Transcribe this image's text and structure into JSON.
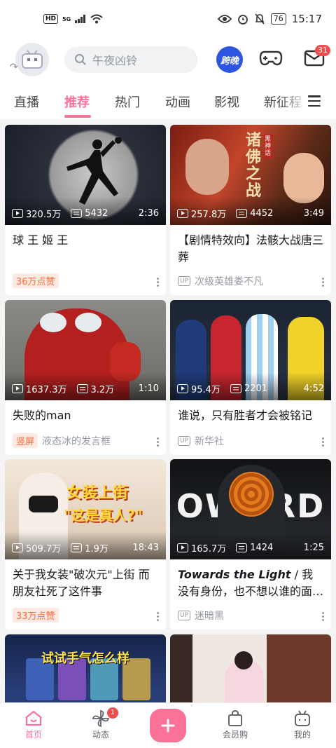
{
  "status_bar": {
    "left_hd": "HD",
    "left_sig": "5G",
    "battery": "76",
    "time": "15:17"
  },
  "header": {
    "search_placeholder": "午夜凶铃",
    "kuawan_label": "跨晚",
    "mail_badge": "31"
  },
  "tabs": [
    {
      "label": "直播",
      "active": false
    },
    {
      "label": "推荐",
      "active": true
    },
    {
      "label": "热门",
      "active": false
    },
    {
      "label": "动画",
      "active": false
    },
    {
      "label": "影视",
      "active": false
    },
    {
      "label": "新征程",
      "active": false
    }
  ],
  "cards": [
    {
      "views": "320.5万",
      "danmaku": "5432",
      "duration": "2:36",
      "title": "球 王 姬 王",
      "tag": "36万点赞",
      "author": ""
    },
    {
      "views": "257.8万",
      "danmaku": "4452",
      "duration": "3:49",
      "title": "【剧情特效向】法骸大战唐三葬",
      "tag": "",
      "up": "UP",
      "author": "次级英雄娄不凡"
    },
    {
      "views": "1637.3万",
      "danmaku": "3.2万",
      "duration": "1:10",
      "title": "失败的man",
      "tag": "竖屏",
      "author": "液态冰的发言框"
    },
    {
      "views": "95.4万",
      "danmaku": "2201",
      "duration": "4:52",
      "title": "谁说，只有胜者才会被铭记",
      "tag": "",
      "up": "UP",
      "author": "新华社"
    },
    {
      "views": "509.7万",
      "danmaku": "1.9万",
      "duration": "18:43",
      "title": "关于我女装\"破次元\"上街 而朋友社死了这件事",
      "tag": "33万点赞",
      "author": ""
    },
    {
      "views": "165.7万",
      "danmaku": "1424",
      "duration": "1:25",
      "title_italic": "Towards the Light",
      "title_rest": " / 我没有身份，也不想以谁的面…",
      "tag": "",
      "up": "UP",
      "author": "迷暗黑"
    }
  ],
  "thumb_text": {
    "card2_vertical": "诸佛之战",
    "card2_small": "黑神话",
    "card5_line1": "女装上街",
    "card5_line2": "\"这是真人?\"",
    "card6_word": "OWORD",
    "card7_caption": "试试手气怎么样"
  },
  "bottom_nav": [
    {
      "label": "首页",
      "active": true
    },
    {
      "label": "动态",
      "badge": "1"
    },
    {
      "label": "会员购"
    },
    {
      "label": "我的"
    }
  ],
  "colors": {
    "accent": "#fb7299",
    "orange": "#ff6b3f",
    "badge_red": "#f04c4c"
  }
}
